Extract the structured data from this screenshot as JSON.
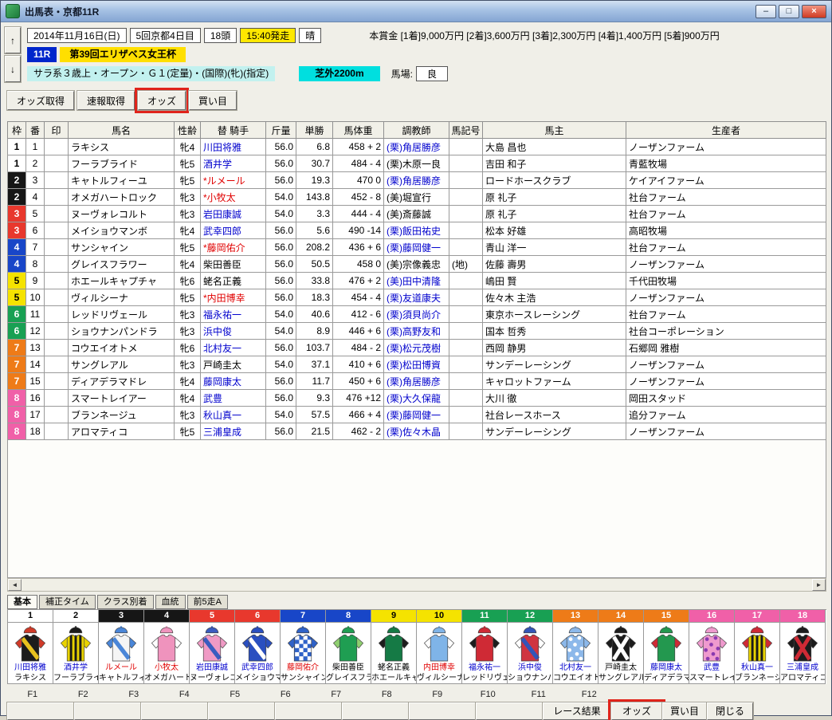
{
  "window": {
    "title": "出馬表・京都11R"
  },
  "icons": {
    "up": "↑",
    "down": "↓",
    "left": "◄",
    "right": "►",
    "minimize": "–",
    "maximize": "□",
    "close": "×"
  },
  "header": {
    "date": "2014年11月16日(日)",
    "meeting": "5回京都4日目",
    "head_count": "18頭",
    "start_time": "15:40発走",
    "weather": "晴",
    "prize": "本賞金 [1着]9,000万円 [2着]3,600万円 [3着]2,300万円 [4着]1,400万円 [5着]900万円",
    "race_no": "11R",
    "race_name": "第39回エリザベス女王杯",
    "race_condition": "サラ系３歳上・オープン・Ｇ１(定量)・(国際)(牝)(指定)",
    "course": "芝外2200m",
    "track_label": "馬場:",
    "track_condition": "良"
  },
  "toolbar": {
    "buttons": [
      "オッズ取得",
      "速報取得",
      "オッズ",
      "買い目"
    ],
    "highlighted": "オッズ"
  },
  "table": {
    "columns": [
      "枠",
      "番",
      "印",
      "馬名",
      "性齢",
      "替 騎手",
      "斤量",
      "単勝",
      "馬体重",
      "調教師",
      "馬記号",
      "馬主",
      "生産者"
    ]
  },
  "frame_colors": {
    "1": {
      "bg": "#ffffff",
      "fg": "#000000"
    },
    "2": {
      "bg": "#161616",
      "fg": "#ffffff"
    },
    "3": {
      "bg": "#e8382d",
      "fg": "#ffffff"
    },
    "4": {
      "bg": "#1846c8",
      "fg": "#ffffff"
    },
    "5": {
      "bg": "#f5e300",
      "fg": "#000000"
    },
    "6": {
      "bg": "#18a053",
      "fg": "#ffffff"
    },
    "7": {
      "bg": "#ee7b18",
      "fg": "#ffffff"
    },
    "8": {
      "bg": "#f060a8",
      "fg": "#ffffff"
    }
  },
  "horses": [
    {
      "frame": 1,
      "num": 1,
      "mark": "",
      "name": "ラキシス",
      "sex_age": "牝4",
      "jockey": "川田将雅",
      "jockey_short": "川田将雅",
      "jockey_color": "blue",
      "weight": "56.0",
      "odds": "6.8",
      "horse_weight": "458 + 2",
      "trainer": "(栗)角居勝彦",
      "trainer_color": "blue",
      "symbol": "",
      "owner": "大島 昌也",
      "breeder": "ノーザンファーム",
      "silk": {
        "body": "#1c1c1c",
        "sleeve": "#d03a28",
        "accent": "#e8c21e",
        "cap": "#d03a28",
        "pattern": "sash"
      }
    },
    {
      "frame": 1,
      "num": 2,
      "mark": "",
      "name": "フーラブライド",
      "sex_age": "牝5",
      "jockey": "酒井学",
      "jockey_short": "酒井学",
      "jockey_color": "blue",
      "weight": "56.0",
      "odds": "30.7",
      "horse_weight": "484 - 4",
      "trainer": "(栗)木原一良",
      "trainer_color": "black",
      "symbol": "",
      "owner": "吉田 和子",
      "breeder": "青藍牧場",
      "silk": {
        "body": "#e8d200",
        "sleeve": "#e8d200",
        "accent": "#1a1a1a",
        "cap": "#1a1a1a",
        "pattern": "stripes"
      }
    },
    {
      "frame": 2,
      "num": 3,
      "mark": "",
      "name": "キャトルフィーユ",
      "sex_age": "牝5",
      "jockey": "*ルメール",
      "jockey_short": "ルメール",
      "jockey_color": "red",
      "weight": "56.0",
      "odds": "19.3",
      "horse_weight": "470    0",
      "trainer": "(栗)角居勝彦",
      "trainer_color": "blue",
      "symbol": "",
      "owner": "ロードホースクラブ",
      "breeder": "ケイアイファーム",
      "silk": {
        "body": "#f5f5f5",
        "sleeve": "#4a86d8",
        "accent": "#4a86d8",
        "cap": "#4a86d8",
        "pattern": "sash"
      }
    },
    {
      "frame": 2,
      "num": 4,
      "mark": "",
      "name": "オメガハートロック",
      "sex_age": "牝3",
      "jockey": "*小牧太",
      "jockey_short": "小牧太",
      "jockey_color": "red",
      "weight": "54.0",
      "odds": "143.8",
      "horse_weight": "452 - 8",
      "trainer": "(美)堀宣行",
      "trainer_color": "black",
      "symbol": "",
      "owner": "原 礼子",
      "breeder": "社台ファーム",
      "silk": {
        "body": "#ef93bd",
        "sleeve": "#ffffff",
        "accent": "#ffffff",
        "cap": "#ef93bd",
        "pattern": "solid"
      }
    },
    {
      "frame": 3,
      "num": 5,
      "mark": "",
      "name": "ヌーヴォレコルト",
      "sex_age": "牝3",
      "jockey": "岩田康誠",
      "jockey_short": "岩田康誠",
      "jockey_color": "blue",
      "weight": "54.0",
      "odds": "3.3",
      "horse_weight": "444 - 4",
      "trainer": "(美)斎藤誠",
      "trainer_color": "black",
      "symbol": "",
      "owner": "原 礼子",
      "breeder": "社台ファーム",
      "silk": {
        "body": "#f09ac5",
        "sleeve": "#f09ac5",
        "accent": "#3a5cc0",
        "cap": "#3a5cc0",
        "pattern": "sash"
      }
    },
    {
      "frame": 3,
      "num": 6,
      "mark": "",
      "name": "メイショウマンボ",
      "sex_age": "牝4",
      "jockey": "武幸四郎",
      "jockey_short": "武幸四郎",
      "jockey_color": "blue",
      "weight": "56.0",
      "odds": "5.6",
      "horse_weight": "490 -14",
      "trainer": "(栗)飯田祐史",
      "trainer_color": "blue",
      "symbol": "",
      "owner": "松本 好雄",
      "breeder": "高昭牧場",
      "silk": {
        "body": "#2a4fc0",
        "sleeve": "#2a4fc0",
        "accent": "#ffffff",
        "cap": "#2a4fc0",
        "pattern": "sash"
      }
    },
    {
      "frame": 4,
      "num": 7,
      "mark": "",
      "name": "サンシャイン",
      "sex_age": "牝5",
      "jockey": "*藤岡佑介",
      "jockey_short": "藤岡佑介",
      "jockey_color": "red",
      "weight": "56.0",
      "odds": "208.2",
      "horse_weight": "436 + 6",
      "trainer": "(栗)藤岡健一",
      "trainer_color": "blue",
      "symbol": "",
      "owner": "青山 洋一",
      "breeder": "社台ファーム",
      "silk": {
        "body": "#2f62c8",
        "sleeve": "#2f62c8",
        "accent": "#ffffff",
        "cap": "#2f62c8",
        "pattern": "checks"
      }
    },
    {
      "frame": 4,
      "num": 8,
      "mark": "",
      "name": "グレイスフラワー",
      "sex_age": "牝4",
      "jockey": "柴田善臣",
      "jockey_short": "柴田善臣",
      "jockey_color": "black",
      "weight": "56.0",
      "odds": "50.5",
      "horse_weight": "458    0",
      "trainer": "(美)宗像義忠",
      "trainer_color": "black",
      "symbol": "(地)",
      "owner": "佐藤 壽男",
      "breeder": "ノーザンファーム",
      "silk": {
        "body": "#1f9e52",
        "sleeve": "#8fcf70",
        "accent": "#ffffff",
        "cap": "#1f9e52",
        "pattern": "solid"
      }
    },
    {
      "frame": 5,
      "num": 9,
      "mark": "",
      "name": "ホエールキャプチャ",
      "sex_age": "牝6",
      "jockey": "蛯名正義",
      "jockey_short": "蛯名正義",
      "jockey_color": "black",
      "weight": "56.0",
      "odds": "33.8",
      "horse_weight": "476 + 2",
      "trainer": "(美)田中清隆",
      "trainer_color": "blue",
      "symbol": "",
      "owner": "嶋田 賢",
      "breeder": "千代田牧場",
      "silk": {
        "body": "#157a45",
        "sleeve": "#1c1c1c",
        "accent": "#ffffff",
        "cap": "#157a45",
        "pattern": "solid"
      }
    },
    {
      "frame": 5,
      "num": 10,
      "mark": "",
      "name": "ヴィルシーナ",
      "sex_age": "牝5",
      "jockey": "*内田博幸",
      "jockey_short": "内田博幸",
      "jockey_color": "red",
      "weight": "56.0",
      "odds": "18.3",
      "horse_weight": "454 - 4",
      "trainer": "(栗)友道康夫",
      "trainer_color": "blue",
      "symbol": "",
      "owner": "佐々木 主浩",
      "breeder": "ノーザンファーム",
      "silk": {
        "body": "#7fb4e8",
        "sleeve": "#ffffff",
        "accent": "#2a50a0",
        "cap": "#7fb4e8",
        "pattern": "solid"
      }
    },
    {
      "frame": 6,
      "num": 11,
      "mark": "",
      "name": "レッドリヴェール",
      "sex_age": "牝3",
      "jockey": "福永祐一",
      "jockey_short": "福永祐一",
      "jockey_color": "blue",
      "weight": "54.0",
      "odds": "40.6",
      "horse_weight": "412 - 6",
      "trainer": "(栗)須貝尚介",
      "trainer_color": "blue",
      "symbol": "",
      "owner": "東京ホースレーシング",
      "breeder": "社台ファーム",
      "silk": {
        "body": "#cf2a35",
        "sleeve": "#1c1c1c",
        "accent": "#ffffff",
        "cap": "#cf2a35",
        "pattern": "solid"
      }
    },
    {
      "frame": 6,
      "num": 12,
      "mark": "",
      "name": "ショウナンパンドラ",
      "sex_age": "牝3",
      "jockey": "浜中俊",
      "jockey_short": "浜中俊",
      "jockey_color": "blue",
      "weight": "54.0",
      "odds": "8.9",
      "horse_weight": "446 + 6",
      "trainer": "(栗)高野友和",
      "trainer_color": "blue",
      "symbol": "",
      "owner": "国本 哲秀",
      "breeder": "社台コーポレーション",
      "silk": {
        "body": "#d03440",
        "sleeve": "#ffffff",
        "accent": "#3355b8",
        "cap": "#3355b8",
        "pattern": "sash"
      }
    },
    {
      "frame": 7,
      "num": 13,
      "mark": "",
      "name": "コウエイオトメ",
      "sex_age": "牝6",
      "jockey": "北村友一",
      "jockey_short": "北村友一",
      "jockey_color": "blue",
      "weight": "56.0",
      "odds": "103.7",
      "horse_weight": "484 - 2",
      "trainer": "(栗)松元茂樹",
      "trainer_color": "blue",
      "symbol": "",
      "owner": "西岡 静男",
      "breeder": "石郷岡 雅樹",
      "silk": {
        "body": "#8cb8ea",
        "sleeve": "#8cb8ea",
        "accent": "#ffffff",
        "cap": "#8cb8ea",
        "pattern": "dots"
      }
    },
    {
      "frame": 7,
      "num": 14,
      "mark": "",
      "name": "サングレアル",
      "sex_age": "牝3",
      "jockey": "戸崎圭太",
      "jockey_short": "戸崎圭太",
      "jockey_color": "black",
      "weight": "54.0",
      "odds": "37.1",
      "horse_weight": "410 + 6",
      "trainer": "(栗)松田博資",
      "trainer_color": "blue",
      "symbol": "",
      "owner": "サンデーレーシング",
      "breeder": "ノーザンファーム",
      "silk": {
        "body": "#1c1c1c",
        "sleeve": "#1c1c1c",
        "accent": "#ffffff",
        "cap": "#1c1c1c",
        "pattern": "cross"
      }
    },
    {
      "frame": 7,
      "num": 15,
      "mark": "",
      "name": "ディアデラマドレ",
      "sex_age": "牝4",
      "jockey": "藤岡康太",
      "jockey_short": "藤岡康太",
      "jockey_color": "blue",
      "weight": "56.0",
      "odds": "11.7",
      "horse_weight": "450 + 6",
      "trainer": "(栗)角居勝彦",
      "trainer_color": "blue",
      "symbol": "",
      "owner": "キャロットファーム",
      "breeder": "ノーザンファーム",
      "silk": {
        "body": "#23984f",
        "sleeve": "#cf2a35",
        "accent": "#ffffff",
        "cap": "#23984f",
        "pattern": "solid"
      }
    },
    {
      "frame": 8,
      "num": 16,
      "mark": "",
      "name": "スマートレイアー",
      "sex_age": "牝4",
      "jockey": "武豊",
      "jockey_short": "武豊",
      "jockey_color": "blue",
      "weight": "56.0",
      "odds": "9.3",
      "horse_weight": "476 +12",
      "trainer": "(栗)大久保龍",
      "trainer_color": "blue",
      "symbol": "",
      "owner": "大川 徹",
      "breeder": "岡田スタッド",
      "silk": {
        "body": "#ef9ace",
        "sleeve": "#ef9ace",
        "accent": "#8a3ab0",
        "cap": "#ef9ace",
        "pattern": "dots"
      }
    },
    {
      "frame": 8,
      "num": 17,
      "mark": "",
      "name": "ブランネージュ",
      "sex_age": "牝3",
      "jockey": "秋山真一",
      "jockey_short": "秋山真一",
      "jockey_color": "blue",
      "weight": "54.0",
      "odds": "57.5",
      "horse_weight": "466 + 4",
      "trainer": "(栗)藤岡健一",
      "trainer_color": "blue",
      "symbol": "",
      "owner": "社台レースホース",
      "breeder": "追分ファーム",
      "silk": {
        "body": "#e8d200",
        "sleeve": "#cf2a35",
        "accent": "#1a1a1a",
        "cap": "#cf2a35",
        "pattern": "stripes"
      }
    },
    {
      "frame": 8,
      "num": 18,
      "mark": "",
      "name": "アロマティコ",
      "sex_age": "牝5",
      "jockey": "三浦皇成",
      "jockey_short": "三浦皇成",
      "jockey_color": "blue",
      "weight": "56.0",
      "odds": "21.5",
      "horse_weight": "462 - 2",
      "trainer": "(栗)佐々木晶",
      "trainer_color": "blue",
      "symbol": "",
      "owner": "サンデーレーシング",
      "breeder": "ノーザンファーム",
      "silk": {
        "body": "#1c1c1c",
        "sleeve": "#1c1c1c",
        "accent": "#cf2a35",
        "cap": "#1c1c1c",
        "pattern": "cross"
      }
    }
  ],
  "tabs": {
    "items": [
      "基本",
      "補正タイム",
      "クラス別着",
      "血統",
      "前5走A"
    ],
    "active": "基本"
  },
  "fkeys": [
    "F1",
    "F2",
    "F3",
    "F4",
    "F5",
    "F6",
    "F7",
    "F8",
    "F9",
    "F10",
    "F11",
    "F12"
  ],
  "bottom": {
    "buttons": [
      "レース結果",
      "オッズ",
      "買い目",
      "閉じる"
    ],
    "highlighted": "オッズ"
  },
  "text_colors": {
    "blue": "#0000cd",
    "red": "#e00000",
    "black": "#000000"
  }
}
